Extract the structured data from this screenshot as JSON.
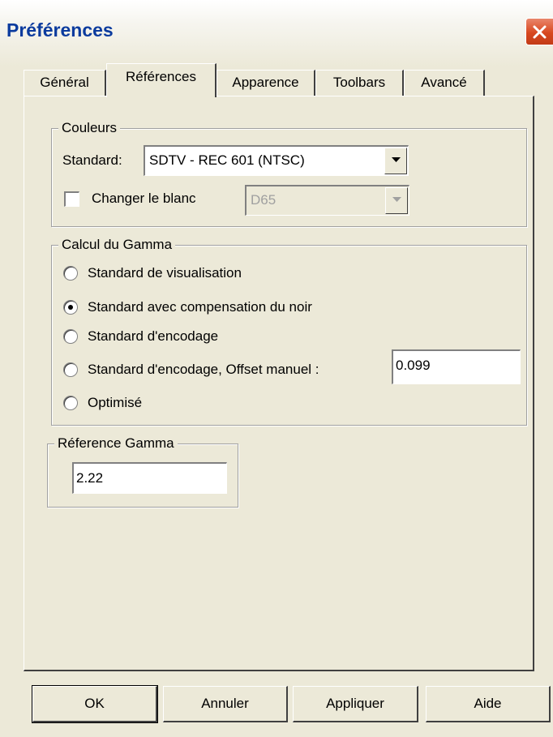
{
  "window": {
    "title": "Préférences"
  },
  "tabs": [
    "Général",
    "Références",
    "Apparence",
    "Toolbars",
    "Avancé"
  ],
  "couleurs": {
    "legend": "Couleurs",
    "standard_label": "Standard:",
    "standard_value": "SDTV - REC 601 (NTSC)",
    "white_checkbox_label": "Changer le blanc",
    "white_checked": false,
    "white_value": "D65"
  },
  "gamma": {
    "legend": "Calcul du Gamma",
    "options": [
      "Standard de visualisation",
      "Standard avec compensation du noir",
      "Standard d'encodage",
      "Standard d'encodage, Offset manuel :",
      "Optimisé"
    ],
    "selected_index": 1,
    "offset_value": "0.099"
  },
  "reference_gamma": {
    "legend": "Réference Gamma",
    "value": "2.22"
  },
  "buttons": {
    "ok": "OK",
    "cancel": "Annuler",
    "apply": "Appliquer",
    "help": "Aide"
  }
}
